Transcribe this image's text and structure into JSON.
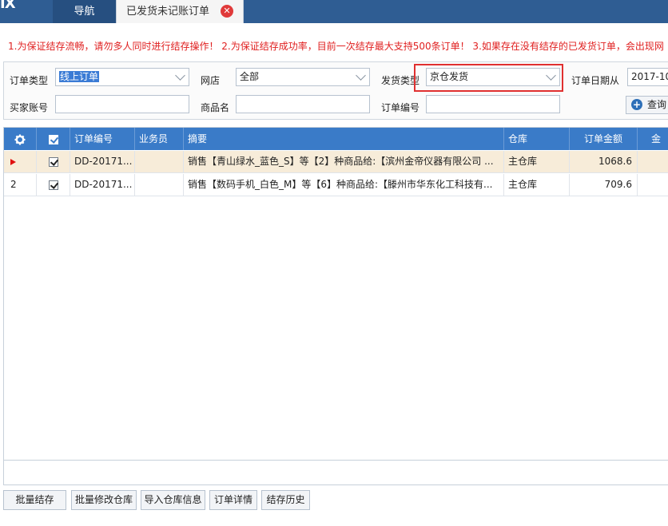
{
  "app": {
    "logo_text": "IX"
  },
  "tabs": {
    "nav_label": "导航",
    "active_label": "已发货未记账订单",
    "close_symbol": "✕"
  },
  "notice": "1.为保证结存流畅，请勿多人同时进行结存操作！ 2.为保证结存成功率，目前一次结存最大支持500条订单！ 3.如果存在没有结存的已发货订单，会出现网",
  "filters": {
    "order_type_label": "订单类型",
    "order_type_value": "线上订单",
    "shop_label": "网店",
    "shop_value": "全部",
    "ship_type_label": "发货类型",
    "ship_type_value": "京仓发货",
    "date_from_label": "订单日期从",
    "date_from_value": "2017-10",
    "buyer_label": "买家账号",
    "buyer_value": "",
    "product_label": "商品名",
    "product_value": "",
    "order_no_label": "订单编号",
    "order_no_value": "",
    "query_label": "查询"
  },
  "grid": {
    "columns": [
      "",
      "",
      "订单编号",
      "业务员",
      "摘要",
      "仓库",
      "订单金额",
      "金"
    ],
    "rows": [
      {
        "index": "",
        "checked": true,
        "order_no": "DD-20171...",
        "salesman": "",
        "summary": "销售【青山绿水_蓝色_S】等【2】种商品给:【滨州金帝仪器有限公司 ...",
        "warehouse": "主仓库",
        "amount": "1068.6"
      },
      {
        "index": "2",
        "checked": true,
        "order_no": "DD-20171...",
        "salesman": "",
        "summary": "销售【数码手机_白色_M】等【6】种商品给:【滕州市华东化工科技有...",
        "warehouse": "主仓库",
        "amount": "709.6"
      }
    ]
  },
  "buttons": {
    "batch_settle": "批量结存",
    "batch_modify_warehouse": "批量修改仓库",
    "import_warehouse_info": "导入仓库信息",
    "order_detail": "订单详情",
    "settle_history": "结存历史"
  },
  "colors": {
    "topbar": "#2f5d93",
    "header": "#3a7bc8",
    "notice": "#e02020",
    "highlight": "#e03030",
    "selected_row": "#f7ecd9"
  }
}
